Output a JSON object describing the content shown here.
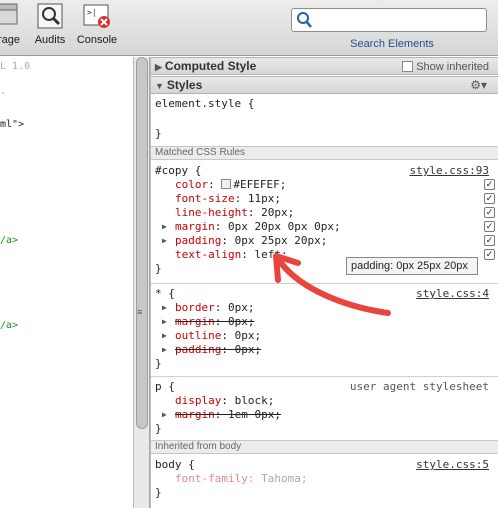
{
  "toolbar": {
    "storage_label": "rage",
    "audits_label": "Audits",
    "console_label": "Console",
    "search_label": "Search Elements"
  },
  "source": {
    "lines": [
      "L 1.0",
      "-",
      "ml\">",
      "/a>",
      "/a>"
    ]
  },
  "computed_style": {
    "title": "Computed Style",
    "show_inherited_label": "Show inherited"
  },
  "styles": {
    "title": "Styles"
  },
  "element_style": {
    "selector": "element.style {",
    "close": "}"
  },
  "matched_rules_label": "Matched CSS Rules",
  "rule_copy": {
    "selector": "#copy {",
    "source": "style.css:93",
    "props": [
      {
        "name": "color",
        "value": "#EFEFEF;"
      },
      {
        "name": "font-size",
        "value": "11px;"
      },
      {
        "name": "line-height",
        "value": "20px;"
      },
      {
        "name": "margin",
        "value": "0px 20px 0px 0px;"
      },
      {
        "name": "padding",
        "value": "0px 25px 20px;"
      },
      {
        "name": "text-align",
        "value": "left;"
      }
    ],
    "close": "}"
  },
  "rule_star": {
    "selector": "* {",
    "source": "style.css:4",
    "props": [
      {
        "name": "border",
        "value": "0px;"
      },
      {
        "name": "margin",
        "value": "0px;"
      },
      {
        "name": "outline",
        "value": "0px;"
      },
      {
        "name": "padding",
        "value": "0px;"
      }
    ],
    "close": "}"
  },
  "rule_p": {
    "selector": "p {",
    "source": "user agent stylesheet",
    "props": [
      {
        "name": "display",
        "value": "block;"
      },
      {
        "name": "margin",
        "value": "1em 0px;"
      }
    ],
    "close": "}"
  },
  "inherited_label": "Inherited from body",
  "rule_body": {
    "selector": "body {",
    "source": "style.css:5",
    "props": [
      {
        "name": "font-family",
        "value": "Tahoma;"
      }
    ],
    "close": "}"
  },
  "tooltip": "padding: 0px 25px 20px",
  "colors": {
    "property": "#c80000",
    "arrow": "#e8463c",
    "link": "#1d4f8f"
  }
}
